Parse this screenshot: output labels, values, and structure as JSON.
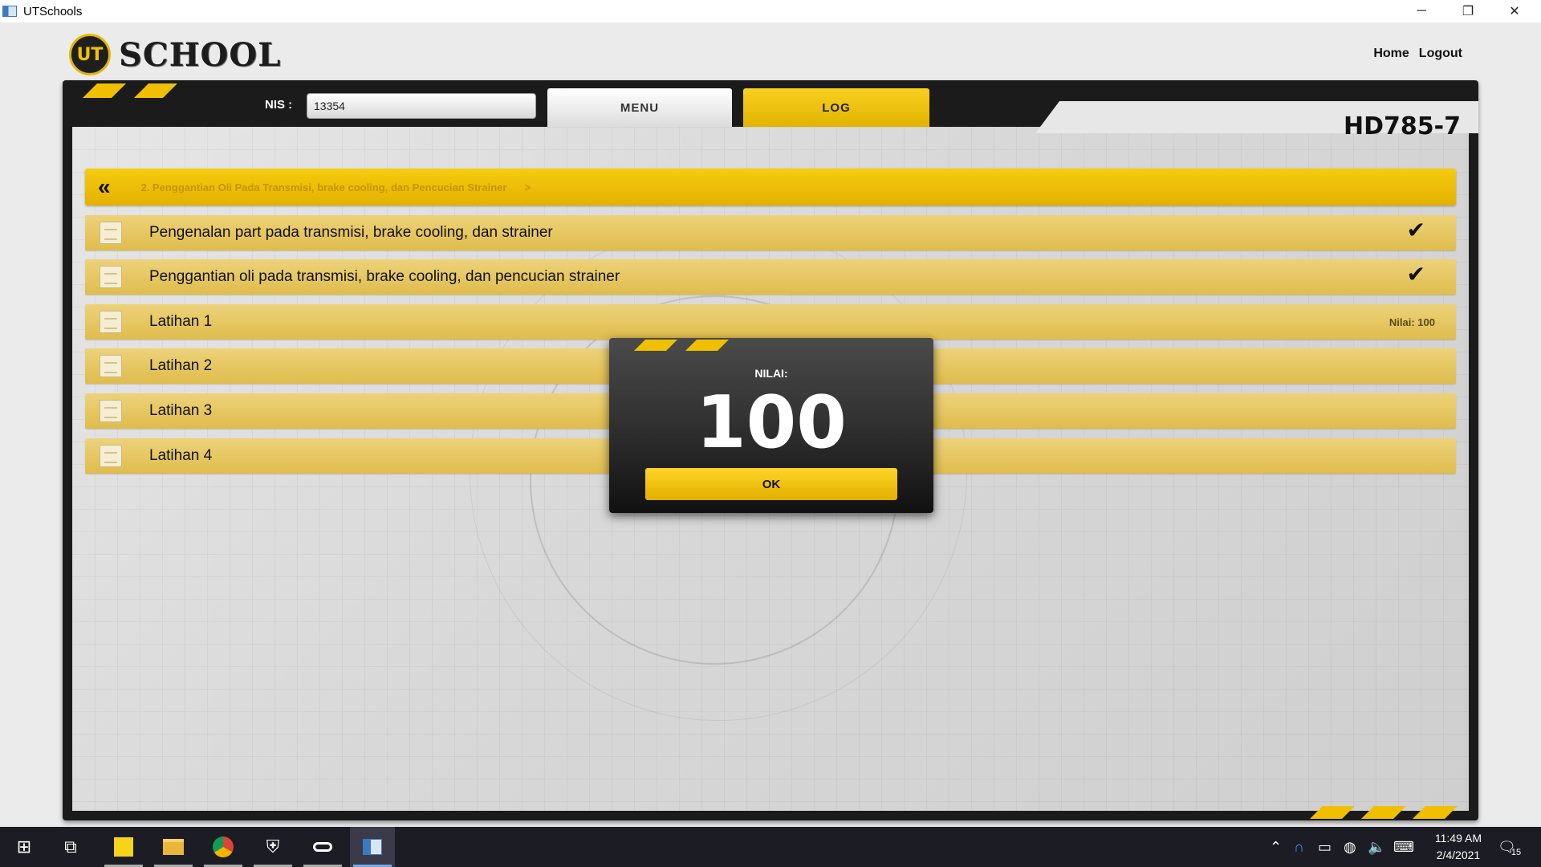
{
  "window": {
    "title": "UTSchools",
    "minimize": "─",
    "restore": "❐",
    "close": "✕"
  },
  "logo": {
    "badge": "UT",
    "text": "SCHOOL"
  },
  "nav": {
    "home": "Home",
    "logout": "Logout"
  },
  "student": {
    "nis_label": "NIS :",
    "nis_value": "13354"
  },
  "tabs": {
    "menu": "MENU",
    "log": "LOG"
  },
  "model": "HD785-7",
  "breadcrumb": {
    "back_icon": "double-chevron-left-icon",
    "back": "«",
    "text": "2. Penggantian Oli Pada Transmisi, brake cooling, dan Pencucian Strainer",
    "arrow": ">"
  },
  "items": [
    {
      "label": "Pengenalan part pada transmisi, brake cooling, dan strainer",
      "status": "✔",
      "status_icon": "check-icon"
    },
    {
      "label": "Penggantian oli pada transmisi, brake cooling, dan pencucian strainer",
      "status": "✔",
      "status_icon": "check-icon"
    },
    {
      "label": "Latihan 1",
      "status": "Nilai: 100"
    },
    {
      "label": "Latihan 2",
      "status": ""
    },
    {
      "label": "Latihan 3",
      "status": ""
    },
    {
      "label": "Latihan 4",
      "status": ""
    }
  ],
  "modal": {
    "label": "NILAI:",
    "score": "100",
    "ok": "OK"
  },
  "colors": {
    "accent": "#f0c000",
    "frame": "#1b1b1b",
    "row": "#e8c964",
    "taskbar": "#1c1c24"
  },
  "taskbar": {
    "icons": [
      "windows-start-icon",
      "task-view-icon",
      "sticky-notes-icon",
      "file-explorer-icon",
      "chrome-icon",
      "security-icon",
      "app-icon",
      "utschools-icon"
    ],
    "time": "11:49 AM",
    "date": "2/4/2021",
    "notifications": "15"
  }
}
